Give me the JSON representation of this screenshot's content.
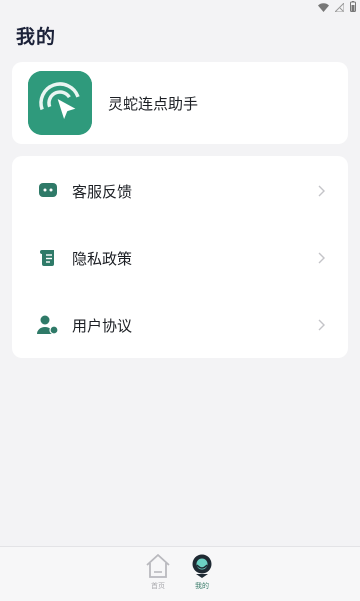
{
  "header": {
    "title": "我的"
  },
  "app": {
    "name": "灵蛇连点助手",
    "brand_color": "#2f9a7c"
  },
  "menu": {
    "items": [
      {
        "label": "客服反馈",
        "icon": "chat-icon"
      },
      {
        "label": "隐私政策",
        "icon": "scroll-icon"
      },
      {
        "label": "用户协议",
        "icon": "user-icon"
      }
    ]
  },
  "nav": {
    "items": [
      {
        "label": "首页",
        "icon": "home-icon",
        "active": false
      },
      {
        "label": "我的",
        "icon": "profile-icon",
        "active": true
      }
    ]
  },
  "colors": {
    "accent": "#2f7a68",
    "title": "#1b2138",
    "background": "#f3f3f5"
  }
}
